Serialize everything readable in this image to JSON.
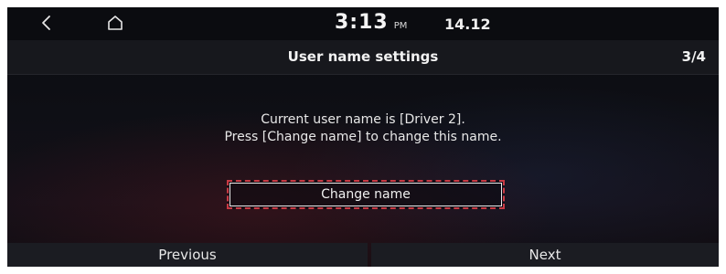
{
  "status_bar": {
    "back_icon": "chevron-left-icon",
    "home_icon": "home-icon",
    "time": "3:13",
    "ampm": "PM",
    "date": "14.12"
  },
  "header": {
    "title": "User name settings",
    "page_indicator": "3/4"
  },
  "message": {
    "line1": "Current user name is [Driver 2].",
    "line2": "Press [Change name] to change this name."
  },
  "change_name_label": "Change name",
  "footer": {
    "previous_label": "Previous",
    "next_label": "Next"
  },
  "colors": {
    "accent": "#c83a44",
    "background": "#0e0f15",
    "text": "#ececec"
  }
}
